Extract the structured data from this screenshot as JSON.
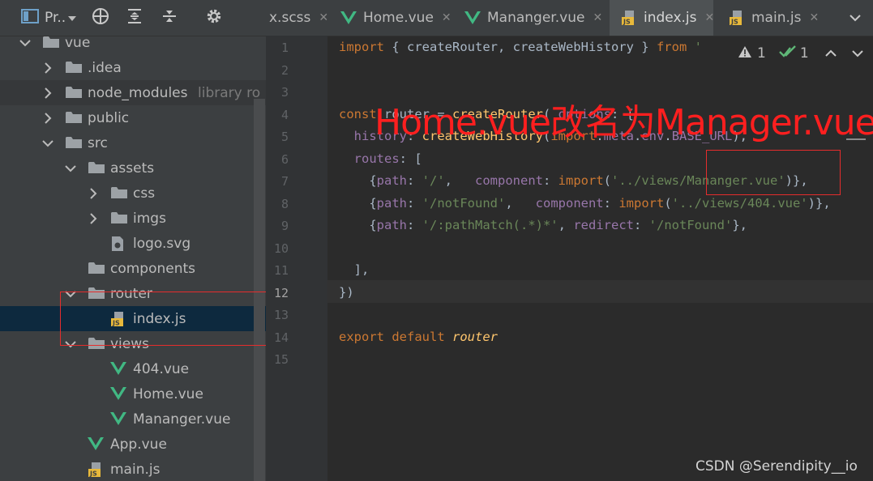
{
  "project_toolbar": {
    "title": "Pr..",
    "icons": [
      "project-view-icon",
      "chevron-down-icon",
      "crosshair-icon",
      "expand-all-icon",
      "collapse-all-icon",
      "gear-icon"
    ]
  },
  "tree": [
    {
      "label": "vue",
      "depth": 1,
      "type": "folder",
      "expanded": true
    },
    {
      "label": ".idea",
      "depth": 2,
      "type": "folder",
      "expanded": false
    },
    {
      "label": "node_modules",
      "depth": 2,
      "type": "folder",
      "expanded": false,
      "hint": "library ro"
    },
    {
      "label": "public",
      "depth": 2,
      "type": "folder",
      "expanded": false
    },
    {
      "label": "src",
      "depth": 2,
      "type": "folder",
      "expanded": true
    },
    {
      "label": "assets",
      "depth": 3,
      "type": "folder",
      "expanded": true
    },
    {
      "label": "css",
      "depth": 4,
      "type": "folder",
      "expanded": false
    },
    {
      "label": "imgs",
      "depth": 4,
      "type": "folder",
      "expanded": false
    },
    {
      "label": "logo.svg",
      "depth": 4,
      "type": "svg"
    },
    {
      "label": "components",
      "depth": 3,
      "type": "folder"
    },
    {
      "label": "router",
      "depth": 3,
      "type": "folder",
      "expanded": true
    },
    {
      "label": "index.js",
      "depth": 4,
      "type": "js"
    },
    {
      "label": "views",
      "depth": 3,
      "type": "folder",
      "expanded": true
    },
    {
      "label": "404.vue",
      "depth": 4,
      "type": "vue"
    },
    {
      "label": "Home.vue",
      "depth": 4,
      "type": "vue"
    },
    {
      "label": "Mananger.vue",
      "depth": 4,
      "type": "vue"
    },
    {
      "label": "App.vue",
      "depth": 3,
      "type": "vue"
    },
    {
      "label": "main.js",
      "depth": 3,
      "type": "js"
    }
  ],
  "tabs": [
    {
      "label": "x.scss",
      "type": "scss",
      "active": false
    },
    {
      "label": "Home.vue",
      "type": "vue",
      "active": false
    },
    {
      "label": "Mananger.vue",
      "type": "vue",
      "active": false
    },
    {
      "label": "index.js",
      "type": "js",
      "active": true
    },
    {
      "label": "main.js",
      "type": "js",
      "active": false
    }
  ],
  "inspections": {
    "warnings": "1",
    "weak_warnings": "1"
  },
  "editor": {
    "line_numbers": [
      "1",
      "2",
      "3",
      "4",
      "5",
      "6",
      "7",
      "8",
      "9",
      "10",
      "11",
      "12",
      "13",
      "14",
      "15"
    ],
    "lines": [
      "import { createRouter, createWebHistory } from '",
      "",
      "",
      "const router = createRouter( options: {",
      "  history: createWebHistory(import.meta.env.BASE_URL),",
      "  routes: [",
      "    {path: '/',   component: import('../views/Mananger.vue')},",
      "    {path: '/notFound',   component: import('../views/404.vue')},",
      "    {path: '/:pathMatch(.*)*', redirect: '/notFound'},",
      "",
      "  ],",
      "})",
      "",
      "export default router",
      ""
    ]
  },
  "annotation": "Home.vue改名为Manager.vue",
  "watermark": "CSDN @Serendipity__io",
  "colors": {
    "annotation_red": "#e52d2d",
    "selection": "#0d293e",
    "vue_green": "#41b883",
    "js_yellow": "#e8b93b"
  }
}
